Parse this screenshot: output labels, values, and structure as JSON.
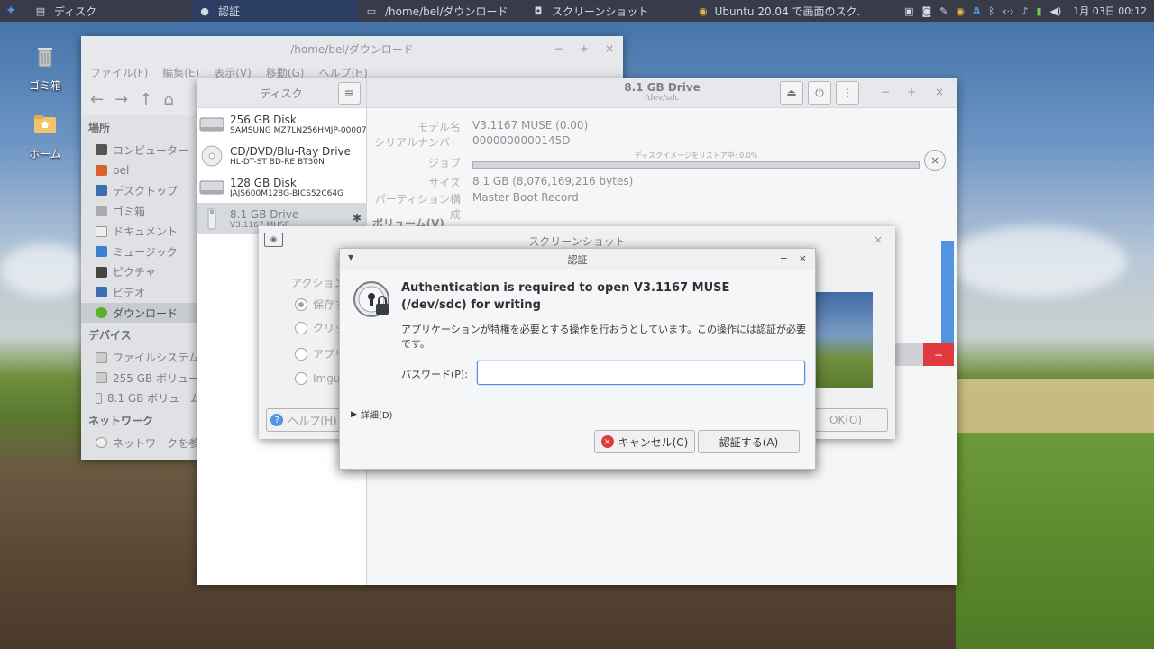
{
  "panel": {
    "tasks": [
      {
        "label": "ディスク",
        "icon": "disks-icon"
      },
      {
        "label": "認証",
        "icon": "auth-icon"
      },
      {
        "label": "/home/bel/ダウンロード",
        "icon": "folder-icon"
      },
      {
        "label": "スクリーンショット",
        "icon": "screenshot-icon"
      },
      {
        "label": "Ubuntu 20.04 で画面のスク...",
        "icon": "chrome-icon"
      }
    ],
    "clock": "1月 03日 00:12"
  },
  "desktop": {
    "trash_label": "ゴミ箱",
    "home_label": "ホーム"
  },
  "file_manager": {
    "title": "/home/bel/ダウンロード",
    "menu": [
      "ファイル(F)",
      "編集(E)",
      "表示(V)",
      "移動(G)",
      "ヘルプ(H)"
    ],
    "places_header": "場所",
    "places": [
      "コンピューター",
      "bel",
      "デスクトップ",
      "ゴミ箱",
      "ドキュメント",
      "ミュージック",
      "ピクチャ",
      "ビデオ",
      "ダウンロード"
    ],
    "devices_header": "デバイス",
    "devices": [
      "ファイルシステム",
      "255 GB ボリューム",
      "8.1 GB ボリューム"
    ],
    "network_header": "ネットワーク",
    "network": [
      "ネットワークを参照"
    ]
  },
  "disks": {
    "sidebar_title": "ディスク",
    "drives": [
      {
        "name": "256 GB Disk",
        "model": "SAMSUNG MZ7LN256HMJP-00007"
      },
      {
        "name": "CD/DVD/Blu-Ray Drive",
        "model": "HL-DT-ST BD-RE BT30N"
      },
      {
        "name": "128 GB Disk",
        "model": "JAJS600M128G-BICS52C64G"
      },
      {
        "name": "8.1 GB Drive",
        "model": "V3.1167 MUSE"
      }
    ],
    "header_title": "8.1 GB Drive",
    "header_sub": "/dev/sdc",
    "fields": {
      "model_label": "モデル名",
      "model_value": "V3.1167 MUSE (0.00)",
      "serial_label": "シリアルナンバー",
      "serial_value": "0000000000145D",
      "job_label": "ジョブ",
      "job_progress_text": "ディスクイメージをリストア中: 0.0%",
      "job_progress": 0.0,
      "size_label": "サイズ",
      "size_value": "8.1 GB (8,076,169,216 bytes)",
      "partition_label": "パーティション構成",
      "partition_value": "Master Boot Record",
      "volumes_label": "ボリューム(V)"
    }
  },
  "screenshot_dialog": {
    "title": "スクリーンショット",
    "action_label": "アクション",
    "options": [
      "保存す",
      "クリッ",
      "アプリ",
      "Imgur"
    ],
    "help_button": "ヘルプ(H)",
    "ok_button": "OK(O)"
  },
  "auth_dialog": {
    "title": "認証",
    "heading": "Authentication is required to open V3.1167 MUSE (/dev/sdc) for writing",
    "description": "アプリケーションが特権を必要とする操作を行おうとしています。この操作には認証が必要です。",
    "password_label": "パスワード(P):",
    "password_value": "",
    "details_label": "詳細(D)",
    "cancel_button": "キャンセル(C)",
    "auth_button": "認証する(A)"
  },
  "colors": {
    "panel_bg": "#383c4a",
    "accent": "#5294e2",
    "cancel_red": "#e0393e"
  }
}
